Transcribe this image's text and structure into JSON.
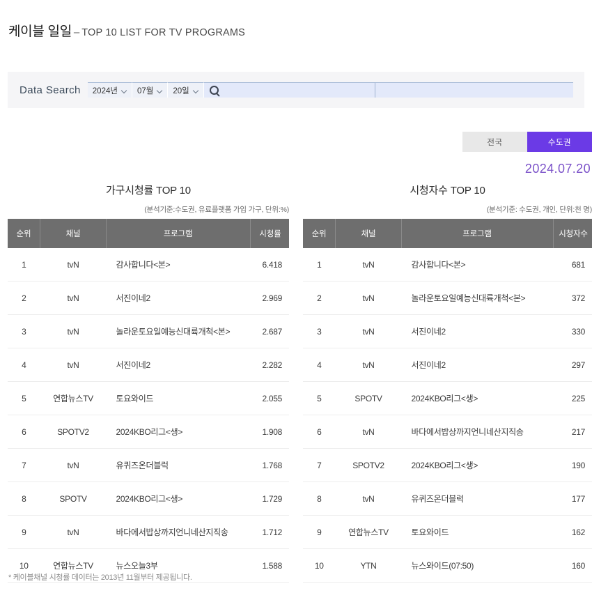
{
  "header": {
    "title_ko": "케이블 일일",
    "dash": "–",
    "title_en": "TOP 10 LIST FOR TV PROGRAMS"
  },
  "search": {
    "label": "Data Search",
    "year": "2024년",
    "month": "07월",
    "day": "20일",
    "search_icon": "search-icon",
    "keyword_value": "",
    "keyword_placeholder": ""
  },
  "region": {
    "nationwide": "전국",
    "metro": "수도권",
    "active": "수도권",
    "active_color": "#6b3ae6"
  },
  "report_date": "2024.07.20",
  "tables": [
    {
      "title": "가구시청률 TOP 10",
      "subtitle": "(분석기준:수도권, 유료플랫폼 가입 가구, 단위:%)",
      "columns": [
        "순위",
        "채널",
        "프로그램",
        "시청률"
      ],
      "rows": [
        {
          "rank": "1",
          "channel": "tvN",
          "program": "감사합니다<본>",
          "value": "6.418"
        },
        {
          "rank": "2",
          "channel": "tvN",
          "program": "서진이네2",
          "value": "2.969"
        },
        {
          "rank": "3",
          "channel": "tvN",
          "program": "놀라운토요일예능신대륙개척<본>",
          "value": "2.687"
        },
        {
          "rank": "4",
          "channel": "tvN",
          "program": "서진이네2",
          "value": "2.282"
        },
        {
          "rank": "5",
          "channel": "연합뉴스TV",
          "program": "토요와이드",
          "value": "2.055"
        },
        {
          "rank": "6",
          "channel": "SPOTV2",
          "program": "2024KBO리그<생>",
          "value": "1.908"
        },
        {
          "rank": "7",
          "channel": "tvN",
          "program": "유퀴즈온더블럭",
          "value": "1.768"
        },
        {
          "rank": "8",
          "channel": "SPOTV",
          "program": "2024KBO리그<생>",
          "value": "1.729"
        },
        {
          "rank": "9",
          "channel": "tvN",
          "program": "바다에서밥상까지언니네산지직송",
          "value": "1.712"
        },
        {
          "rank": "10",
          "channel": "연합뉴스TV",
          "program": "뉴스오늘3부",
          "value": "1.588"
        }
      ]
    },
    {
      "title": "시청자수 TOP 10",
      "subtitle": "(분석기준: 수도권, 개인, 단위:천 명)",
      "columns": [
        "순위",
        "채널",
        "프로그램",
        "시청자수"
      ],
      "rows": [
        {
          "rank": "1",
          "channel": "tvN",
          "program": "감사합니다<본>",
          "value": "681"
        },
        {
          "rank": "2",
          "channel": "tvN",
          "program": "놀라운토요일예능신대륙개척<본>",
          "value": "372"
        },
        {
          "rank": "3",
          "channel": "tvN",
          "program": "서진이네2",
          "value": "330"
        },
        {
          "rank": "4",
          "channel": "tvN",
          "program": "서진이네2",
          "value": "297"
        },
        {
          "rank": "5",
          "channel": "SPOTV",
          "program": "2024KBO리그<생>",
          "value": "225"
        },
        {
          "rank": "6",
          "channel": "tvN",
          "program": "바다에서밥상까지언니네산지직송",
          "value": "217"
        },
        {
          "rank": "7",
          "channel": "SPOTV2",
          "program": "2024KBO리그<생>",
          "value": "190"
        },
        {
          "rank": "8",
          "channel": "tvN",
          "program": "유퀴즈온더블럭",
          "value": "177"
        },
        {
          "rank": "9",
          "channel": "연합뉴스TV",
          "program": "토요와이드",
          "value": "162"
        },
        {
          "rank": "10",
          "channel": "YTN",
          "program": "뉴스와이드(07:50)",
          "value": "160"
        }
      ]
    }
  ],
  "footnote": "* 케이블채널 시청률 데이터는 2013년 11월부터 제공됩니다."
}
